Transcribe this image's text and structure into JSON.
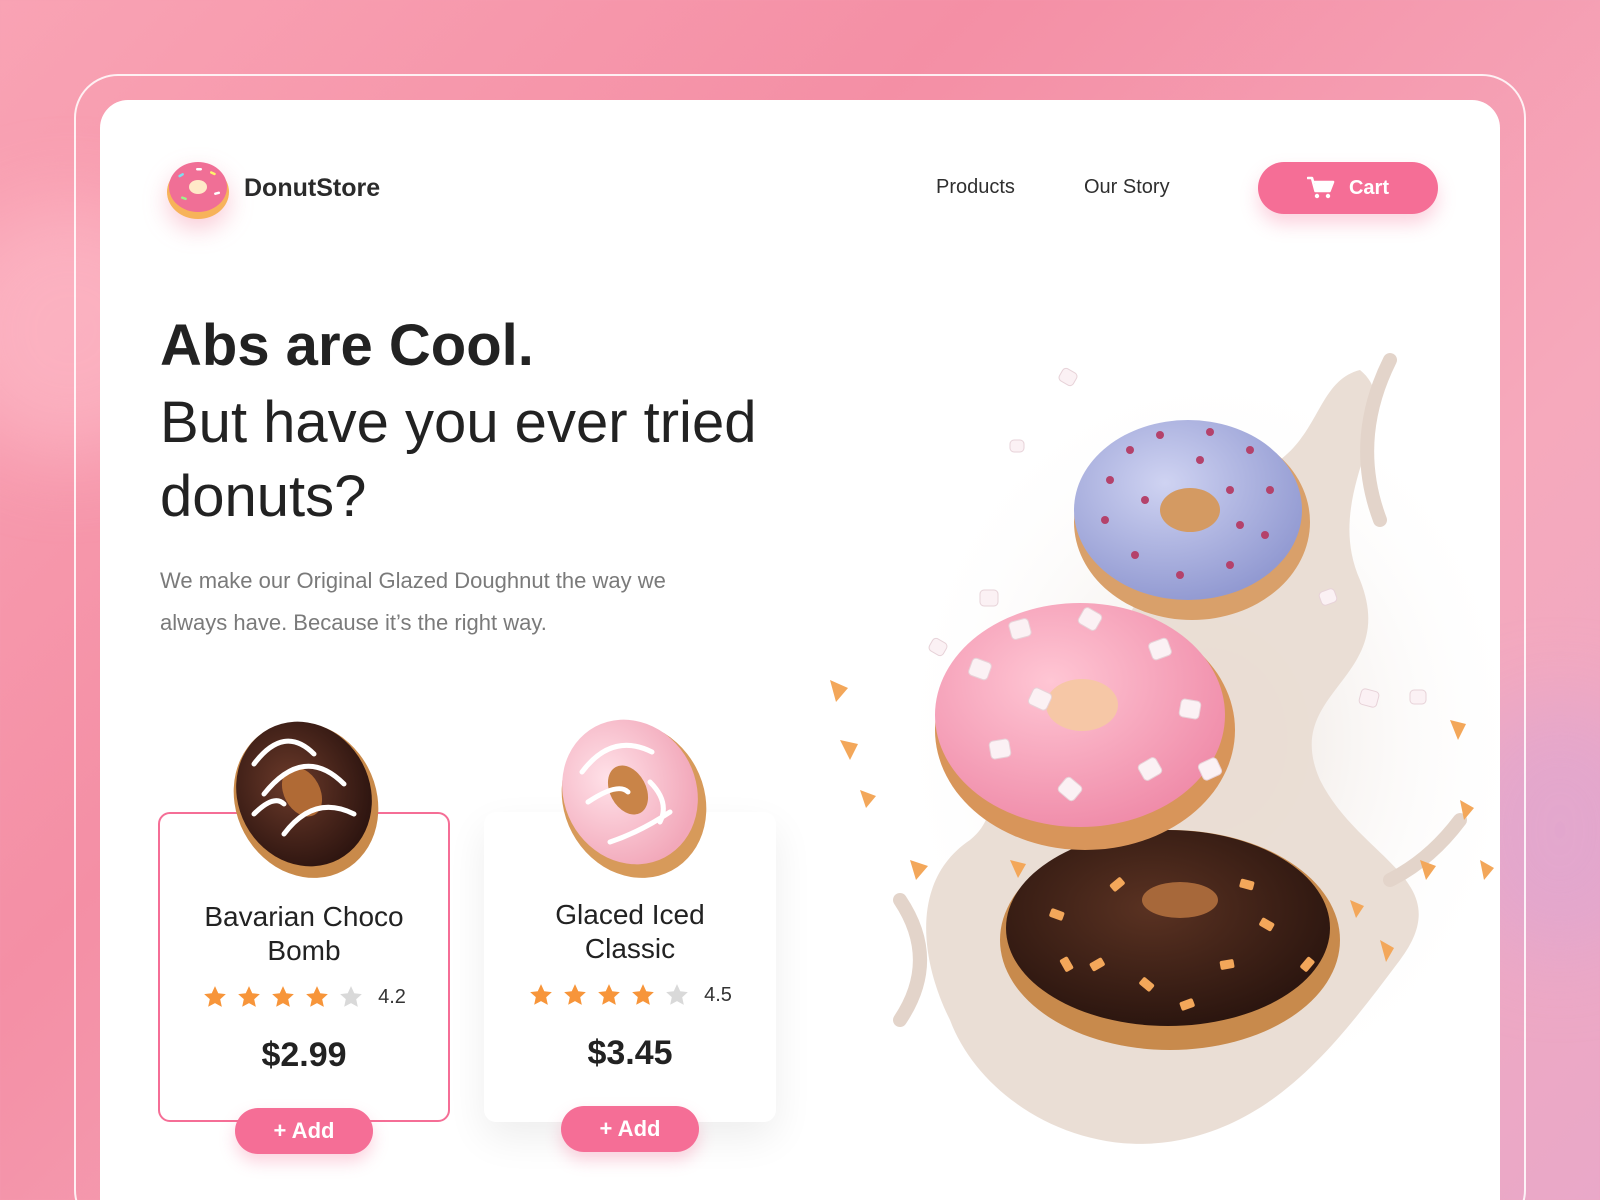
{
  "brand": {
    "name": "DonutStore"
  },
  "nav": {
    "products": "Products",
    "our_story": "Our Story",
    "cart": "Cart"
  },
  "hero": {
    "headline": "Abs are Cool.",
    "subheadline": "But have you ever tried donuts?",
    "description": "We make our Original Glazed Doughnut the way we always have. Because it’s the right way."
  },
  "products": [
    {
      "name": "Bavarian Choco Bomb",
      "rating": "4.2",
      "stars": 4,
      "price": "$2.99",
      "add_label": "+ Add"
    },
    {
      "name": "Glaced Iced Classic",
      "rating": "4.5",
      "stars": 4,
      "price": "$3.45",
      "add_label": "+ Add"
    }
  ],
  "icons": {
    "logo": "donut-icon",
    "cart": "cart-icon",
    "star": "star-icon"
  },
  "colors": {
    "accent": "#f56e96",
    "star": "#f7953a",
    "star_empty": "#d9d9d9"
  }
}
